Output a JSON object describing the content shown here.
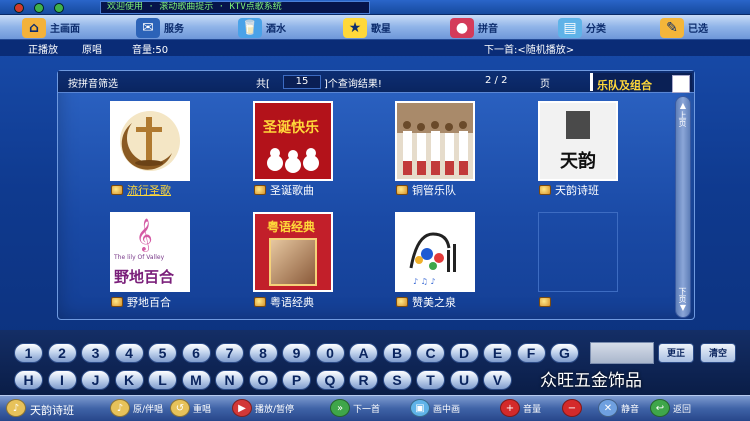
{
  "window": {
    "marquee": "欢迎使用 · 滚动歌曲提示 · KTV点歌系统"
  },
  "top_nav": [
    {
      "label": "主画面",
      "icon": "home-icon",
      "color": "#f3b23a"
    },
    {
      "label": "服务",
      "icon": "service-bell-icon",
      "color": "#2c63b8"
    },
    {
      "label": "酒水",
      "icon": "drink-glass-icon",
      "color": "#4aa2e8"
    },
    {
      "label": "歌星",
      "icon": "singer-star-icon",
      "color": "#ffd83a"
    },
    {
      "label": "拼音",
      "icon": "pinyin-fruit-icon",
      "color": "#d43b5a"
    },
    {
      "label": "分类",
      "icon": "category-books-icon",
      "color": "#5fb3e8"
    },
    {
      "label": "已选",
      "icon": "selected-list-icon",
      "color": "#f4b63a"
    }
  ],
  "status": {
    "now_playing": "正播放",
    "track_mode": "原唱",
    "volume": "音量:50",
    "next_song": "下一首:<随机播放>"
  },
  "panel": {
    "filter_label": "按拼音筛选",
    "total_prefix": "共[",
    "total_count": "15",
    "total_suffix": "]个查询结果!",
    "page_indicator": "2 / 2",
    "page_unit": "页",
    "category": "乐队及组合"
  },
  "tiles": [
    {
      "label": "流行圣歌",
      "selected": true
    },
    {
      "label": "圣诞歌曲",
      "selected": false
    },
    {
      "label": "铜管乐队",
      "selected": false
    },
    {
      "label": "天韵诗班",
      "selected": false
    },
    {
      "label": "野地百合",
      "selected": false
    },
    {
      "label": "粤语经典",
      "selected": false
    },
    {
      "label": "赞美之泉",
      "selected": false
    },
    {
      "label": "",
      "selected": false
    }
  ],
  "tile_art": {
    "cover_4": "天韵",
    "cover_5": "野地百合",
    "cover_5_small": "The lily Of Valley",
    "cover_6": "粤语经典",
    "cover_2": "圣诞快乐"
  },
  "scroll": {
    "up": "上页",
    "down": "下页"
  },
  "keyboard": {
    "row1": [
      "1",
      "2",
      "3",
      "4",
      "5",
      "6",
      "7",
      "8",
      "9",
      "0",
      "A",
      "B",
      "C",
      "D",
      "E",
      "F",
      "G"
    ],
    "row2": [
      "H",
      "I",
      "J",
      "K",
      "L",
      "M",
      "N",
      "O",
      "P",
      "Q",
      "R",
      "S",
      "T",
      "U",
      "V"
    ],
    "correct_label": "更正",
    "clear_label": "清空"
  },
  "bottom_bar": [
    {
      "label": "原/伴唱",
      "icon": "mic-icon",
      "color": "#e7c25a"
    },
    {
      "label": "重唱",
      "icon": "replay-icon",
      "color": "#e7c25a"
    },
    {
      "label": "播放/暂停",
      "icon": "play-pause-icon",
      "color": "#d23838"
    },
    {
      "label": "下一首",
      "icon": "next-track-icon",
      "color": "#3fa64a"
    },
    {
      "label": "画中画",
      "icon": "pip-icon",
      "color": "#5fb3e8"
    },
    {
      "label": "音量",
      "icon": "volume-up-icon",
      "color": "#d42a2a"
    },
    {
      "label": "",
      "icon": "volume-down-icon",
      "color": "#d42a2a"
    },
    {
      "label": "静音",
      "icon": "mute-icon",
      "color": "#6fa0e0"
    },
    {
      "label": "返回",
      "icon": "back-icon",
      "color": "#3fa64a"
    }
  ],
  "brand": "天韵诗班",
  "watermark": "众旺五金饰品"
}
